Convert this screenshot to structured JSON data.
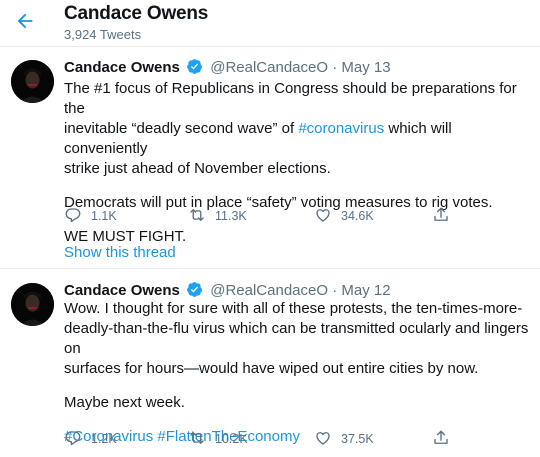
{
  "header": {
    "title": "Candace Owens",
    "tweet_count": "3,924 Tweets",
    "back_icon": "arrow-left-icon"
  },
  "colors": {
    "accent": "#1b95e0",
    "text": "#0f1419",
    "secondary": "#5b7083",
    "divider": "#e6ecf0"
  },
  "tweets": [
    {
      "name": "Candace Owens",
      "handle": "@RealCandaceO",
      "separator": "·",
      "date": "May 13",
      "body": {
        "l1": "The #1 focus of Republicans in Congress should be preparations for the",
        "l2_before": "inevitable “deadly second wave” of ",
        "l2_tag": "#coronavirus",
        "l2_after": " which will conveniently",
        "l3": "strike just ahead of November elections.",
        "l4": "Democrats will put in place “safety” voting measures to rig votes.",
        "l5": "WE MUST FIGHT."
      },
      "replies": "1.1K",
      "retweets": "11.3K",
      "likes": "34.6K",
      "show_thread": "Show this thread"
    },
    {
      "name": "Candace Owens",
      "handle": "@RealCandaceO",
      "separator": "·",
      "date": "May 12",
      "body": {
        "l1": "Wow. I thought for sure with all of these protests, the ten-times-more-",
        "l2": "deadly-than-the-flu virus which can be transmitted ocularly and lingers on",
        "l3": "surfaces for hours—would have wiped out entire cities by now.",
        "l4": "Maybe next week.",
        "tag1": "#Coronavirus",
        "tag2": "#FlattenTheEconomy"
      },
      "replies": "1.2K",
      "retweets": "10.2K",
      "likes": "37.5K"
    }
  ]
}
